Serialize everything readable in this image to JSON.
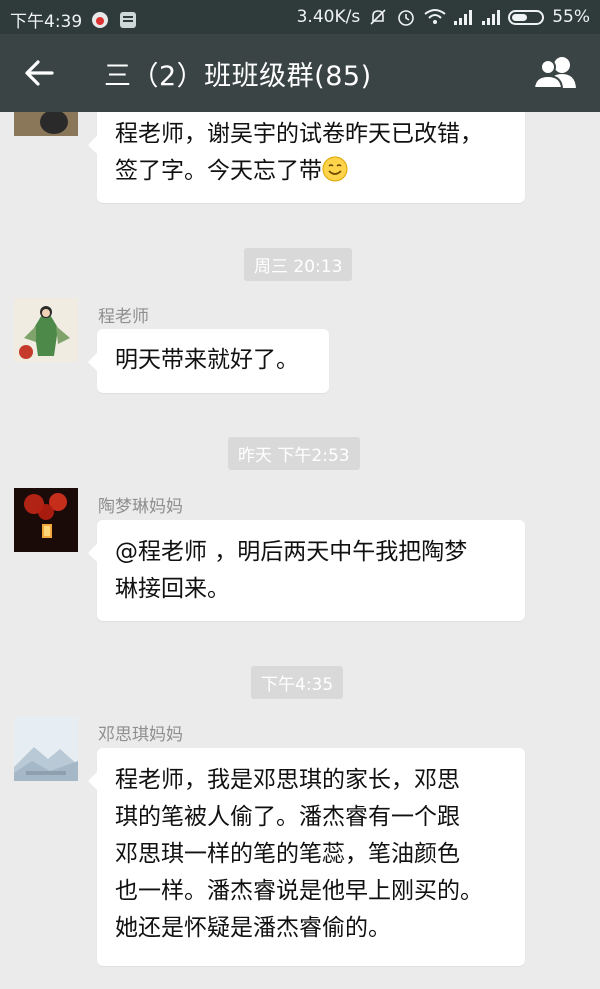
{
  "status_bar": {
    "time": "下午4:39",
    "network_speed": "3.40K/s",
    "battery": "55%",
    "battery_level": 0.55
  },
  "header": {
    "title": "三（2）班班级群(85)",
    "back_icon": "back-arrow-icon",
    "members_icon": "group-members-icon"
  },
  "messages": [
    {
      "sender": "",
      "lines": [
        "程老师，谢吴宇的试卷昨天已改错，",
        "签了字。今天忘了带"
      ],
      "emoji": "smile-emoji-icon"
    },
    {
      "timestamp": "周三 20:13",
      "sender": "程老师",
      "lines": [
        "明天带来就好了。"
      ]
    },
    {
      "timestamp": "昨天 下午2:53",
      "sender": "陶梦琳妈妈",
      "lines": [
        "@程老师 ，明后两天中午我把陶梦",
        "琳接回来。"
      ]
    },
    {
      "timestamp": "下午4:35",
      "sender": "邓思琪妈妈",
      "lines": [
        "程老师，我是邓思琪的家长，邓思",
        "琪的笔被人偷了。潘杰睿有一个跟",
        "邓思琪一样的笔的笔蕊，笔油颜色",
        "也一样。潘杰睿说是他早上刚买的。",
        "她还是怀疑是潘杰睿偷的。"
      ]
    }
  ],
  "colors": {
    "statusbar": "#2f3b3b",
    "titlebar": "#3a4444",
    "background": "#ebebeb",
    "bubble": "#ffffff",
    "timestamp_bg": "#d9d9d9"
  }
}
